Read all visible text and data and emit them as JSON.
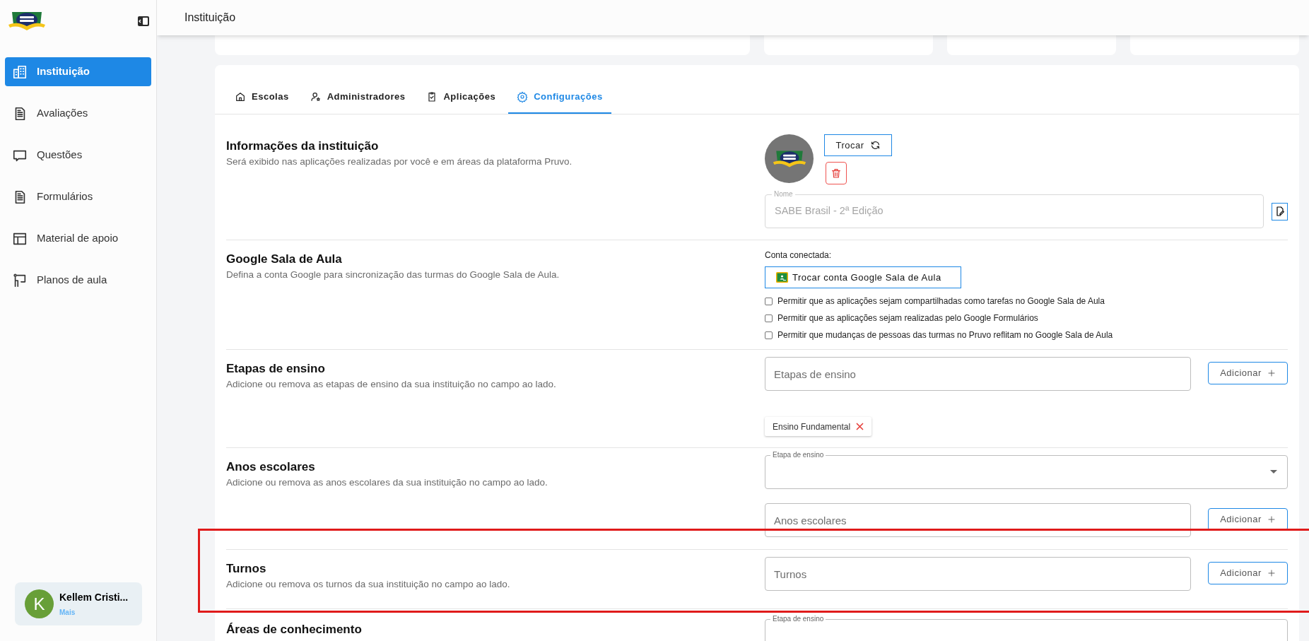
{
  "sidebar": {
    "items": [
      {
        "label": "Instituição",
        "selected": true
      },
      {
        "label": "Avaliações",
        "selected": false
      },
      {
        "label": "Questões",
        "selected": false
      },
      {
        "label": "Formulários",
        "selected": false
      },
      {
        "label": "Material de apoio",
        "selected": false
      },
      {
        "label": "Planos de aula",
        "selected": false
      }
    ],
    "user": {
      "initial": "K",
      "name": "Kellem Cristi...",
      "link": "Mais"
    }
  },
  "header": {
    "title": "Instituição"
  },
  "stats": [
    {
      "kind": "card"
    },
    {
      "kind": "card"
    },
    {
      "kind": "card"
    }
  ],
  "tabs": [
    {
      "label": "Escolas",
      "selected": false
    },
    {
      "label": "Administradores",
      "selected": false
    },
    {
      "label": "Aplicações",
      "selected": false
    },
    {
      "label": "Configurações",
      "selected": true
    }
  ],
  "sections": [
    {
      "kind": "logo",
      "title": "Informações da instituição",
      "description": "Será exibido nas aplicações realizadas por você e em áreas da plataforma Pruvo.",
      "button": "Trocar",
      "field": {
        "label": "Nome",
        "value": "SABE Brasil - 2ª Edição",
        "disabled": true
      }
    },
    {
      "kind": "google",
      "title": "Google Sala de Aula",
      "description": "Defina a conta Google para sincronização das turmas do Google Sala de Aula.",
      "connected_label": "Conta conectada:",
      "button": "Trocar conta Google Sala de Aula",
      "options": [
        {
          "label": "Permitir que as aplicações sejam compartilhadas como tarefas no Google Sala de Aula",
          "checked": false
        },
        {
          "label": "Permitir que as aplicações sejam realizadas pelo Google Formulários",
          "checked": false
        },
        {
          "label": "Permitir que mudanças de pessoas das turmas no Pruvo reflitam no Google Sala de Aula",
          "checked": false
        }
      ]
    },
    {
      "kind": "tags",
      "title": "Etapas de ensino",
      "description": "Adicione ou remova as etapas de ensino da sua instituição no campo ao lado.",
      "placeholder": "Etapas de ensino",
      "button": "Adicionar",
      "chips": [
        {
          "label": "Ensino Fundamental"
        }
      ]
    },
    {
      "kind": "select_add",
      "title": "Anos escolares",
      "description": "Adicione ou remova as anos escolares da sua instituição no campo ao lado.",
      "select_label": "Etapa de ensino",
      "placeholder": "Anos escolares",
      "button": "Adicionar"
    },
    {
      "kind": "add",
      "highlighted": true,
      "title": "Turnos",
      "description": "Adicione ou remova os turnos da sua instituição no campo ao lado.",
      "placeholder": "Turnos",
      "button": "Adicionar"
    },
    {
      "kind": "partial",
      "title": "Áreas de conhecimento",
      "select_label": "Etapa de ensino"
    }
  ]
}
